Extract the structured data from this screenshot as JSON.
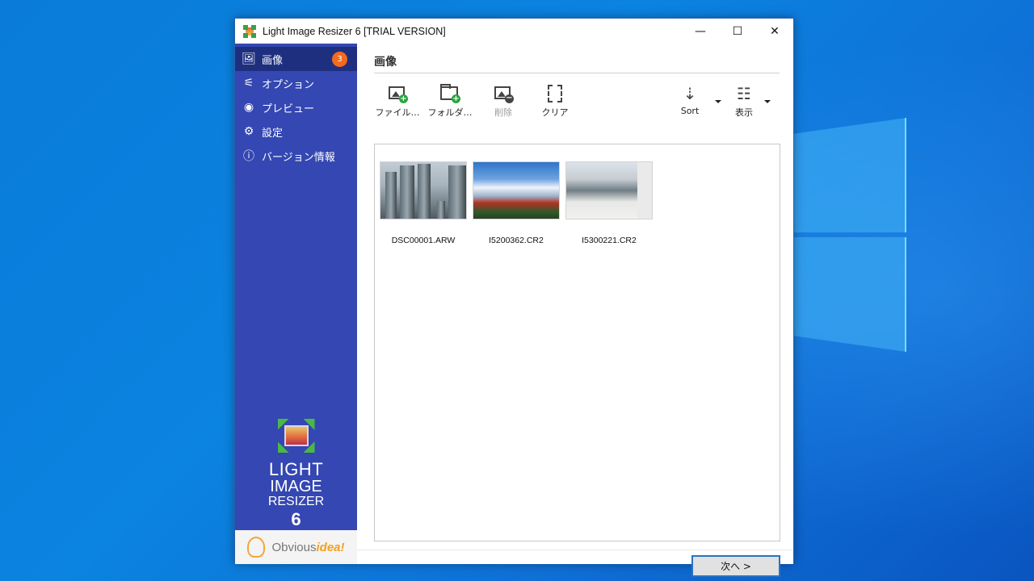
{
  "window": {
    "title": "Light Image Resizer 6  [TRIAL VERSION]",
    "controls": {
      "minimize": "—",
      "maximize": "☐",
      "close": "✕"
    }
  },
  "sidebar": {
    "items": [
      {
        "label": "画像",
        "icon": "images-icon",
        "glyph": "🖼",
        "badge": "3",
        "active": true
      },
      {
        "label": "オプション",
        "icon": "sliders-icon",
        "glyph": "⚟"
      },
      {
        "label": "プレビュー",
        "icon": "eye-icon",
        "glyph": "◉"
      },
      {
        "label": "設定",
        "icon": "gear-icon",
        "glyph": "⚙"
      },
      {
        "label": "バージョン情報",
        "icon": "info-icon",
        "glyph": "ⓘ"
      }
    ],
    "logo": {
      "line1": "LIGHT",
      "line2": "IMAGE",
      "line3": "RESIZER",
      "line4": "6"
    },
    "brand": {
      "part1": "Obvious",
      "part2": "idea!"
    }
  },
  "main": {
    "section_title": "画像",
    "toolbar": {
      "add_files": "ファイル…",
      "add_folder": "フォルダ…",
      "remove": "削除",
      "clear": "クリア",
      "sort": "Sort",
      "view": "表示"
    },
    "images": [
      {
        "name": "DSC00001.ARW"
      },
      {
        "name": "I5200362.CR2"
      },
      {
        "name": "I5300221.CR2"
      }
    ],
    "next_button": "次へ >"
  },
  "colors": {
    "sidebar": "#3447b2",
    "sidebar_active": "#1f2f80",
    "badge": "#f26b1d",
    "accent_button_border": "#2a73c2",
    "add_green": "#26a63f"
  }
}
